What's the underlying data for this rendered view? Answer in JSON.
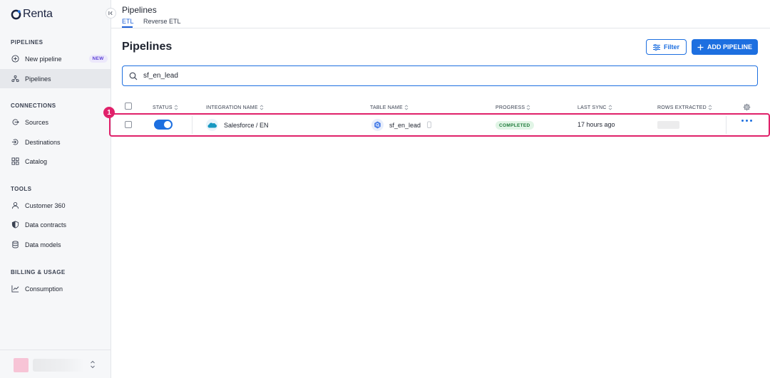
{
  "app": {
    "logo_text": "Renta"
  },
  "sidebar": {
    "sections": [
      {
        "title": "PIPELINES"
      },
      {
        "title": "CONNECTIONS"
      },
      {
        "title": "TOOLS"
      },
      {
        "title": "BILLING & USAGE"
      }
    ],
    "items": [
      {
        "label": "New pipeline",
        "icon": "plus-circle-icon",
        "badge": "NEW"
      },
      {
        "label": "Pipelines",
        "icon": "pipelines-icon",
        "active": true
      },
      {
        "label": "Sources",
        "icon": "source-icon"
      },
      {
        "label": "Destinations",
        "icon": "destination-icon"
      },
      {
        "label": "Catalog",
        "icon": "grid-icon"
      },
      {
        "label": "Customer 360",
        "icon": "user-icon"
      },
      {
        "label": "Data contracts",
        "icon": "shield-icon"
      },
      {
        "label": "Data models",
        "icon": "database-icon"
      },
      {
        "label": "Consumption",
        "icon": "chart-line-icon"
      }
    ]
  },
  "header": {
    "title": "Pipelines",
    "tabs": [
      {
        "label": "ETL",
        "active": true
      },
      {
        "label": "Reverse ETL",
        "active": false
      }
    ]
  },
  "main": {
    "title": "Pipelines",
    "filter_label": "Filter",
    "add_label": "ADD PIPELINE",
    "search_value": "sf_en_lead",
    "columns": [
      "STATUS",
      "INTEGRATION NAME",
      "TABLE NAME",
      "PROGRESS",
      "LAST SYNC",
      "ROWS EXTRACTED"
    ],
    "rows": [
      {
        "status_on": true,
        "integration": "Salesforce / EN",
        "table": "sf_en_lead",
        "progress": "COMPLETED",
        "last_sync": "17 hours ago"
      }
    ],
    "marker": "1"
  },
  "colors": {
    "accent": "#1d6fe0",
    "highlight": "#e0216a",
    "success": "#1e7a3a"
  }
}
